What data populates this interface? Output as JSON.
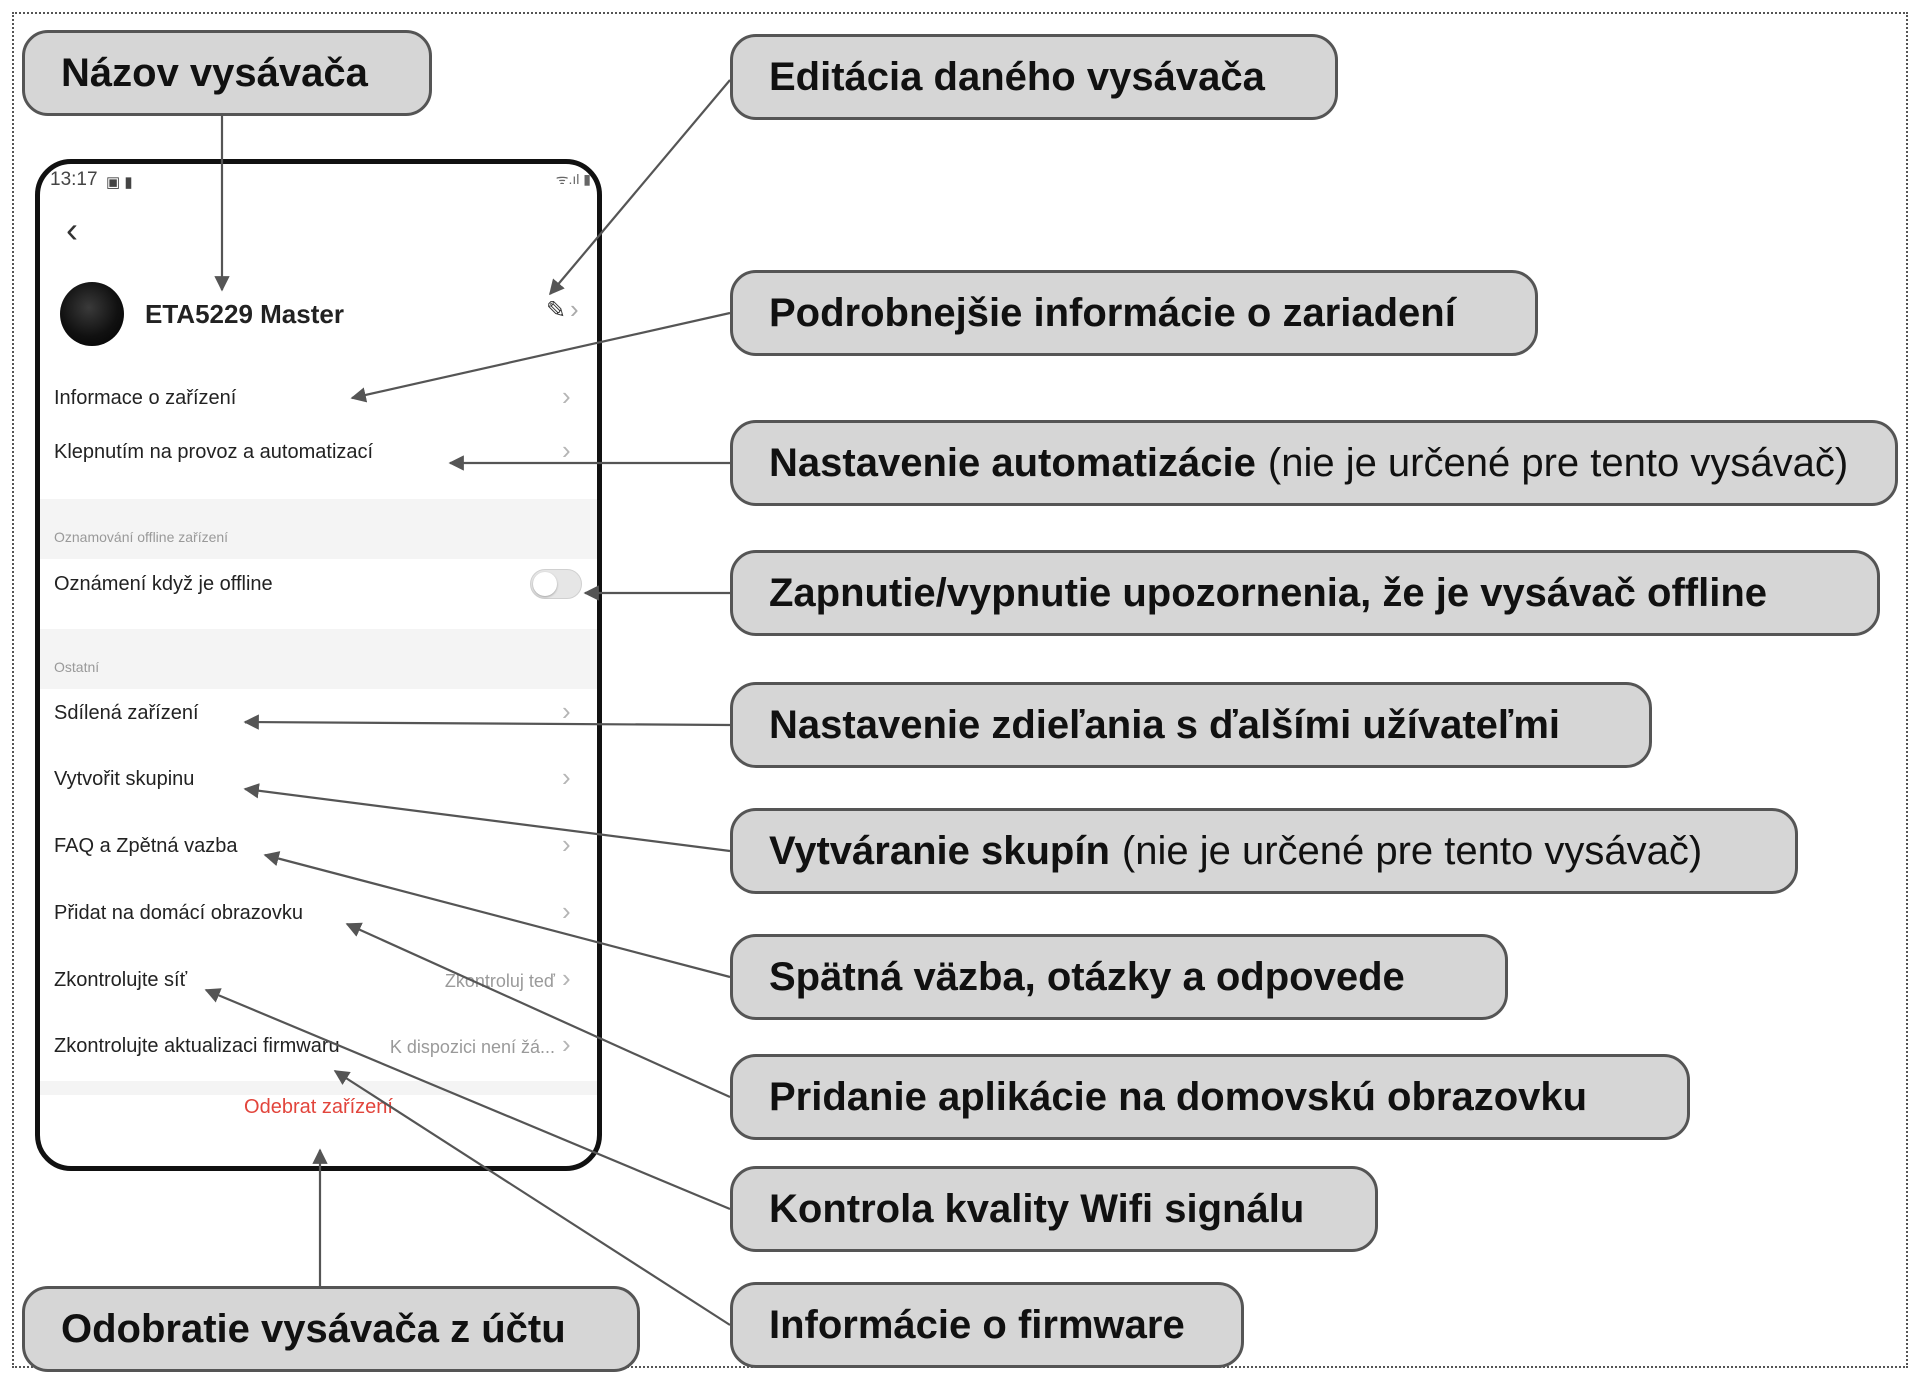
{
  "phone": {
    "status_time": "13:17",
    "status_icons": "▣ ▮",
    "status_right": "ᯤ.ıl ▮",
    "back": "‹",
    "device_name": "ETA5229 Master",
    "edit_glyph": "✎",
    "chevron": "›",
    "rows": {
      "info": "Informace o zařízení",
      "automation": "Klepnutím na provoz a automatizací",
      "offline_caption": "Oznamování offline zařízení",
      "offline": "Oznámení když je offline",
      "other_caption": "Ostatní",
      "shared": "Sdílená zařízení",
      "group": "Vytvořit skupinu",
      "faq": "FAQ a Zpětná vazba",
      "home": "Přidat na domácí obrazovku",
      "network": "Zkontrolujte síť",
      "network_value": "Zkontroluj teď",
      "firmware": "Zkontrolujte aktualizaci firmwaru",
      "firmware_value": "K dispozici není žá...",
      "remove": "Odebrat zařízení"
    },
    "offline_toggle_on": false
  },
  "callouts": {
    "name": "Názov vysávača",
    "edit": "Editácia daného vysávača",
    "details": "Podrobnejšie informácie o zariadení",
    "automation_bold": "Nastavenie automatizácie",
    "automation_note": "(nie je určené pre tento vysávač)",
    "offline": "Zapnutie/vypnutie upozornenia, že je vysávač offline",
    "sharing": "Nastavenie zdieľania s ďalšími užívateľmi",
    "groups_bold": "Vytváranie skupín",
    "groups_note": "(nie je určené pre tento vysávač)",
    "feedback": "Spätná väzba, otázky a odpovede",
    "homescreen": "Pridanie aplikácie na domovskú obrazovku",
    "wifi": "Kontrola kvality Wifi signálu",
    "firmware": "Informácie o firmware",
    "remove": "Odobratie vysávača z účtu"
  },
  "colors": {
    "callout_fill": "#d6d6d6",
    "callout_border": "#555555",
    "remove_text": "#e2453c"
  }
}
